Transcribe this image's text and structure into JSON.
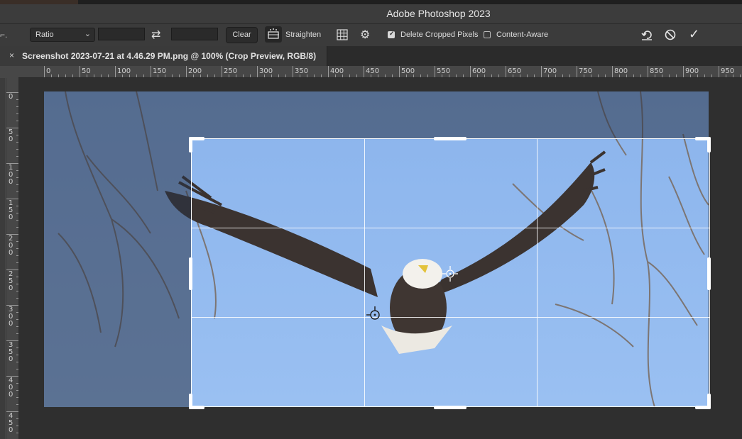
{
  "app": {
    "title": "Adobe Photoshop 2023"
  },
  "options_bar": {
    "tool_menu_glyph": "⌐.",
    "ratio_select": {
      "value": "Ratio"
    },
    "width_field": {
      "value": ""
    },
    "height_field": {
      "value": ""
    },
    "swap_icon": "swap-arrows-icon",
    "clear_label": "Clear",
    "straighten_label": "Straighten",
    "overlay_icon": "grid-overlay-icon",
    "settings_icon": "gear-icon",
    "delete_cropped": {
      "label": "Delete Cropped Pixels",
      "checked": true
    },
    "content_aware": {
      "label": "Content-Aware",
      "checked": false
    },
    "reset_icon": "reset-icon",
    "cancel_icon": "cancel-icon",
    "commit_icon": "checkmark-icon"
  },
  "document_tab": {
    "close_glyph": "×",
    "name": "Screenshot 2023-07-21 at 4.46.29 PM.png @ 100% (Crop Preview, RGB/8)"
  },
  "ruler": {
    "h_labels": [
      "0",
      "50",
      "100",
      "150",
      "200",
      "250",
      "300",
      "350",
      "400",
      "450",
      "500",
      "550",
      "600",
      "650",
      "700",
      "750",
      "800",
      "850",
      "900",
      "950"
    ],
    "v_labels": [
      "0",
      "50",
      "100",
      "150",
      "200",
      "250",
      "300",
      "350",
      "400",
      "450"
    ]
  },
  "colors": {
    "sky": "#8fb7ee",
    "panel": "#3b3b3b",
    "canvas": "#2f2f2f"
  }
}
